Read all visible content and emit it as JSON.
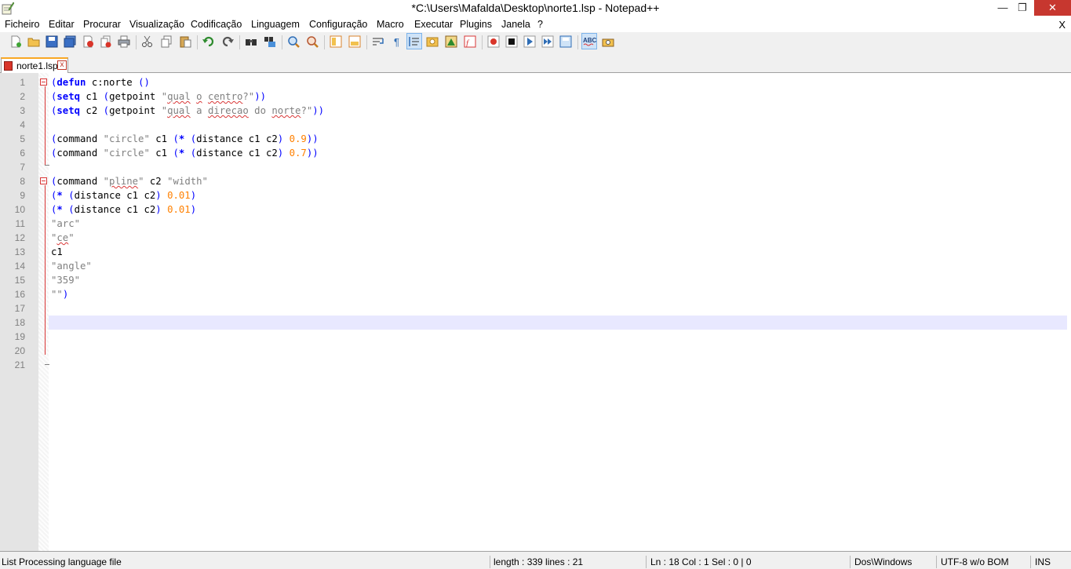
{
  "window": {
    "title": "*C:\\Users\\Mafalda\\Desktop\\norte1.lsp - Notepad++",
    "minimize_glyph": "—",
    "maximize_glyph": "❐",
    "close_glyph": "✕"
  },
  "menu": {
    "items": [
      "Ficheiro",
      "Editar",
      "Procurar",
      "Visualização",
      "Codificação",
      "Linguagem",
      "Configuração",
      "Macro",
      "Executar",
      "Plugins",
      "Janela",
      "?"
    ],
    "close_doc": "X"
  },
  "toolbar": {
    "icons": [
      "new-file-icon",
      "open-file-icon",
      "save-icon",
      "save-all-icon",
      "close-icon",
      "close-all-icon",
      "print-icon",
      "cut-icon",
      "copy-icon",
      "paste-icon",
      "undo-icon",
      "redo-icon",
      "find-icon",
      "replace-icon",
      "zoom-in-icon",
      "zoom-out-icon",
      "sync-vertical-icon",
      "sync-horizontal-icon",
      "word-wrap-icon",
      "show-all-chars-icon",
      "indent-guide-icon",
      "user-language-icon",
      "doc-map-icon",
      "function-list-icon",
      "record-macro-icon",
      "stop-macro-icon",
      "play-macro-icon",
      "run-macro-multiple-icon",
      "save-macro-icon",
      "spell-check-icon",
      "plugin-icon"
    ],
    "spell_check_label": "ABC"
  },
  "tabs": [
    {
      "label": "norte1.lsp",
      "unsaved": true,
      "close_glyph": "x"
    }
  ],
  "editor": {
    "current_line": 18,
    "lines": [
      {
        "n": "1",
        "fold": "open",
        "tokens": [
          {
            "t": "(",
            "c": "p"
          },
          {
            "t": "defun",
            "c": "k"
          },
          {
            "t": " c:norte ",
            "c": ""
          },
          {
            "t": "()",
            "c": "p"
          }
        ]
      },
      {
        "n": "2",
        "tokens": [
          {
            "t": "(",
            "c": "p"
          },
          {
            "t": "setq",
            "c": "k"
          },
          {
            "t": " c1 ",
            "c": ""
          },
          {
            "t": "(",
            "c": "p"
          },
          {
            "t": "getpoint ",
            "c": ""
          },
          {
            "t": "\"",
            "c": "s"
          },
          {
            "t": "qual",
            "c": "s sq"
          },
          {
            "t": " ",
            "c": "s"
          },
          {
            "t": "o",
            "c": "s sq"
          },
          {
            "t": " ",
            "c": "s"
          },
          {
            "t": "centro",
            "c": "s sq"
          },
          {
            "t": "?\"",
            "c": "s"
          },
          {
            "t": "))",
            "c": "p"
          }
        ]
      },
      {
        "n": "3",
        "tokens": [
          {
            "t": "(",
            "c": "p"
          },
          {
            "t": "setq",
            "c": "k"
          },
          {
            "t": " c2 ",
            "c": ""
          },
          {
            "t": "(",
            "c": "p"
          },
          {
            "t": "getpoint ",
            "c": ""
          },
          {
            "t": "\"",
            "c": "s"
          },
          {
            "t": "qual",
            "c": "s sq"
          },
          {
            "t": " a ",
            "c": "s"
          },
          {
            "t": "direcao",
            "c": "s sq"
          },
          {
            "t": " do ",
            "c": "s"
          },
          {
            "t": "norte",
            "c": "s sq"
          },
          {
            "t": "?\"",
            "c": "s"
          },
          {
            "t": "))",
            "c": "p"
          }
        ]
      },
      {
        "n": "4",
        "tokens": []
      },
      {
        "n": "5",
        "tokens": [
          {
            "t": "(",
            "c": "p"
          },
          {
            "t": "command ",
            "c": ""
          },
          {
            "t": "\"circle\"",
            "c": "s"
          },
          {
            "t": " c1 ",
            "c": ""
          },
          {
            "t": "(",
            "c": "p"
          },
          {
            "t": "*",
            "c": "k"
          },
          {
            "t": " ",
            "c": ""
          },
          {
            "t": "(",
            "c": "p"
          },
          {
            "t": "distance c1 c2",
            "c": ""
          },
          {
            "t": ")",
            "c": "p"
          },
          {
            "t": " ",
            "c": ""
          },
          {
            "t": "0.9",
            "c": "n"
          },
          {
            "t": "))",
            "c": "p"
          }
        ]
      },
      {
        "n": "6",
        "tokens": [
          {
            "t": "(",
            "c": "p"
          },
          {
            "t": "command ",
            "c": ""
          },
          {
            "t": "\"circle\"",
            "c": "s"
          },
          {
            "t": " c1 ",
            "c": ""
          },
          {
            "t": "(",
            "c": "p"
          },
          {
            "t": "*",
            "c": "k"
          },
          {
            "t": " ",
            "c": ""
          },
          {
            "t": "(",
            "c": "p"
          },
          {
            "t": "distance c1 c2",
            "c": ""
          },
          {
            "t": ")",
            "c": "p"
          },
          {
            "t": " ",
            "c": ""
          },
          {
            "t": "0.7",
            "c": "n"
          },
          {
            "t": "))",
            "c": "p"
          }
        ]
      },
      {
        "n": "7",
        "tokens": []
      },
      {
        "n": "8",
        "fold": "open",
        "tokens": [
          {
            "t": "(",
            "c": "p"
          },
          {
            "t": "command ",
            "c": ""
          },
          {
            "t": "\"",
            "c": "s"
          },
          {
            "t": "pline",
            "c": "s sq"
          },
          {
            "t": "\"",
            "c": "s"
          },
          {
            "t": " c2 ",
            "c": ""
          },
          {
            "t": "\"width\"",
            "c": "s"
          }
        ]
      },
      {
        "n": "9",
        "tokens": [
          {
            "t": "(",
            "c": "p"
          },
          {
            "t": "*",
            "c": "k"
          },
          {
            "t": " ",
            "c": ""
          },
          {
            "t": "(",
            "c": "p"
          },
          {
            "t": "distance c1 c2",
            "c": ""
          },
          {
            "t": ")",
            "c": "p"
          },
          {
            "t": " ",
            "c": ""
          },
          {
            "t": "0.01",
            "c": "n"
          },
          {
            "t": ")",
            "c": "p"
          }
        ]
      },
      {
        "n": "10",
        "tokens": [
          {
            "t": "(",
            "c": "p"
          },
          {
            "t": "*",
            "c": "k"
          },
          {
            "t": " ",
            "c": ""
          },
          {
            "t": "(",
            "c": "p"
          },
          {
            "t": "distance c1 c2",
            "c": ""
          },
          {
            "t": ")",
            "c": "p"
          },
          {
            "t": " ",
            "c": ""
          },
          {
            "t": "0.01",
            "c": "n"
          },
          {
            "t": ")",
            "c": "p"
          }
        ]
      },
      {
        "n": "11",
        "tokens": [
          {
            "t": "\"arc\"",
            "c": "s"
          }
        ]
      },
      {
        "n": "12",
        "tokens": [
          {
            "t": "\"",
            "c": "s"
          },
          {
            "t": "ce",
            "c": "s sq"
          },
          {
            "t": "\"",
            "c": "s"
          }
        ]
      },
      {
        "n": "13",
        "tokens": [
          {
            "t": "c1",
            "c": ""
          }
        ]
      },
      {
        "n": "14",
        "tokens": [
          {
            "t": "\"angle\"",
            "c": "s"
          }
        ]
      },
      {
        "n": "15",
        "tokens": [
          {
            "t": "\"359\"",
            "c": "s"
          }
        ]
      },
      {
        "n": "16",
        "tokens": [
          {
            "t": "\"\"",
            "c": "s"
          },
          {
            "t": ")",
            "c": "p"
          }
        ]
      },
      {
        "n": "17",
        "tokens": []
      },
      {
        "n": "18",
        "tokens": []
      },
      {
        "n": "19",
        "tokens": []
      },
      {
        "n": "20",
        "tokens": []
      },
      {
        "n": "21",
        "tokens": []
      }
    ]
  },
  "status": {
    "language": "List Processing language file",
    "length_lines": "length : 339    lines : 21",
    "position": "Ln : 18    Col : 1    Sel : 0 | 0",
    "eol": "Dos\\Windows",
    "encoding": "UTF-8 w/o BOM",
    "mode": "INS"
  },
  "colors": {
    "keyword": "#0000ff",
    "string": "#808080",
    "number": "#ff8000",
    "current_line_bg": "#e8e8ff",
    "fold_marker": "#d93636",
    "close_button": "#c7372f"
  }
}
